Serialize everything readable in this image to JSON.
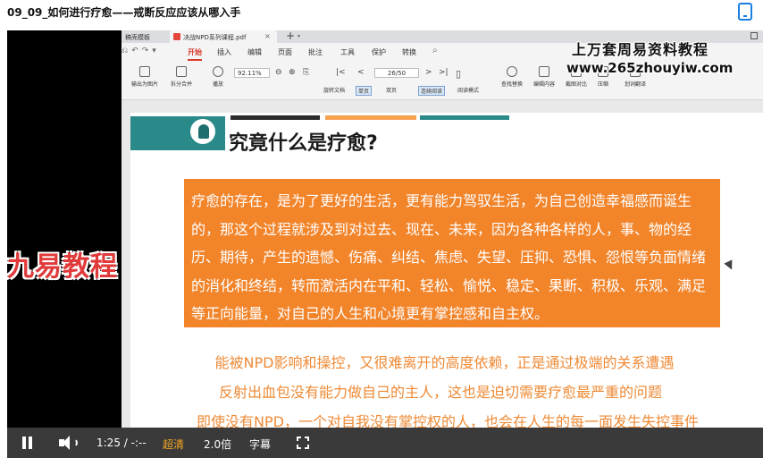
{
  "header": {
    "title": "09_09_如何进行疗愈——戒断反应应该从哪入手"
  },
  "wps": {
    "tabs": [
      "稿壳模板",
      "决战NPD系列课程.pdf"
    ],
    "menu": [
      "开始",
      "插入",
      "编辑",
      "页面",
      "批注",
      "工具",
      "保护",
      "转换"
    ],
    "toolbar": {
      "export_image": "输出为图片",
      "split_merge": "拆分合并",
      "play": "播放",
      "rotate": "旋转文档",
      "single": "单页",
      "double": "双页",
      "continuous": "连续阅读",
      "read_mode": "阅读模式",
      "find_replace": "查找替换",
      "edit_content": "编辑内容",
      "screenshot_compare": "截图对比",
      "compress": "压缩",
      "translate": "划词翻译",
      "zoom": "92.11%",
      "page": "26/50"
    }
  },
  "document": {
    "heading": "究竟什么是疗愈?",
    "paragraph": "疗愈的存在，是为了更好的生活，更有能力驾驭生活，为自己创造幸福感而诞生的，那这个过程就涉及到对过去、现在、未来，因为各种各样的人，事、物的经历、期待，产生的遗憾、伤痛、纠结、焦虑、失望、压抑、恐惧、怨恨等负面情绪的消化和终结，转而激活内在平和、轻松、愉悦、稳定、果断、积极、乐观、满足等正向能量，对自己的人生和心境更有掌控感和自主权。",
    "quotes": [
      "能被NPD影响和操控，又很难离开的高度依赖，正是通过极端的关系遭遇",
      "反射出血包没有能力做自己的主人，这也是迫切需要疗愈最严重的问题",
      "即使没有NPD，一个对自我没有掌控权的人，也会在人生的每一面发生失控事件"
    ]
  },
  "watermarks": {
    "site_title": "上万套周易资料教程",
    "site_url": "www.265zhouyiw.com",
    "brand": "九易教程"
  },
  "player": {
    "time": "1:25 / -:--",
    "quality": "超清",
    "speed": "2.0倍",
    "subtitle": "字幕"
  },
  "colors": {
    "accent_orange": "#f2842a",
    "teal": "#2a8a8a",
    "brand_red": "#e03a3a",
    "quality_gold": "#f5a623"
  }
}
